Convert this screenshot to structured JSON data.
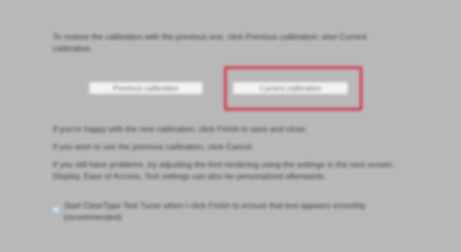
{
  "intro": {
    "line1": "To restore the calibration with the previous one, click Previous calibration; else Current",
    "line2": "calibration."
  },
  "buttons": {
    "left_label": "Previous calibration",
    "right_label": "Current calibration"
  },
  "notes": {
    "line1": "If you're happy with the new calibration, click Finish to save and close.",
    "line2": "If you wish to use the previous calibration, click Cancel.",
    "line3": "If you still have problems, try adjusting the font rendering using the settings in the next screen.",
    "line4": "Display, Ease of Access, Text settings can also be personalized afterwards."
  },
  "checkbox": {
    "checked": true,
    "label_line1": "Start ClearType Text Tuner when I click Finish to ensure that text appears smoothly",
    "label_line2": "(recommended)"
  },
  "colors": {
    "background": "#b8b8b8",
    "highlight": "#d33a4e",
    "button_face": "#f2f2f2"
  }
}
